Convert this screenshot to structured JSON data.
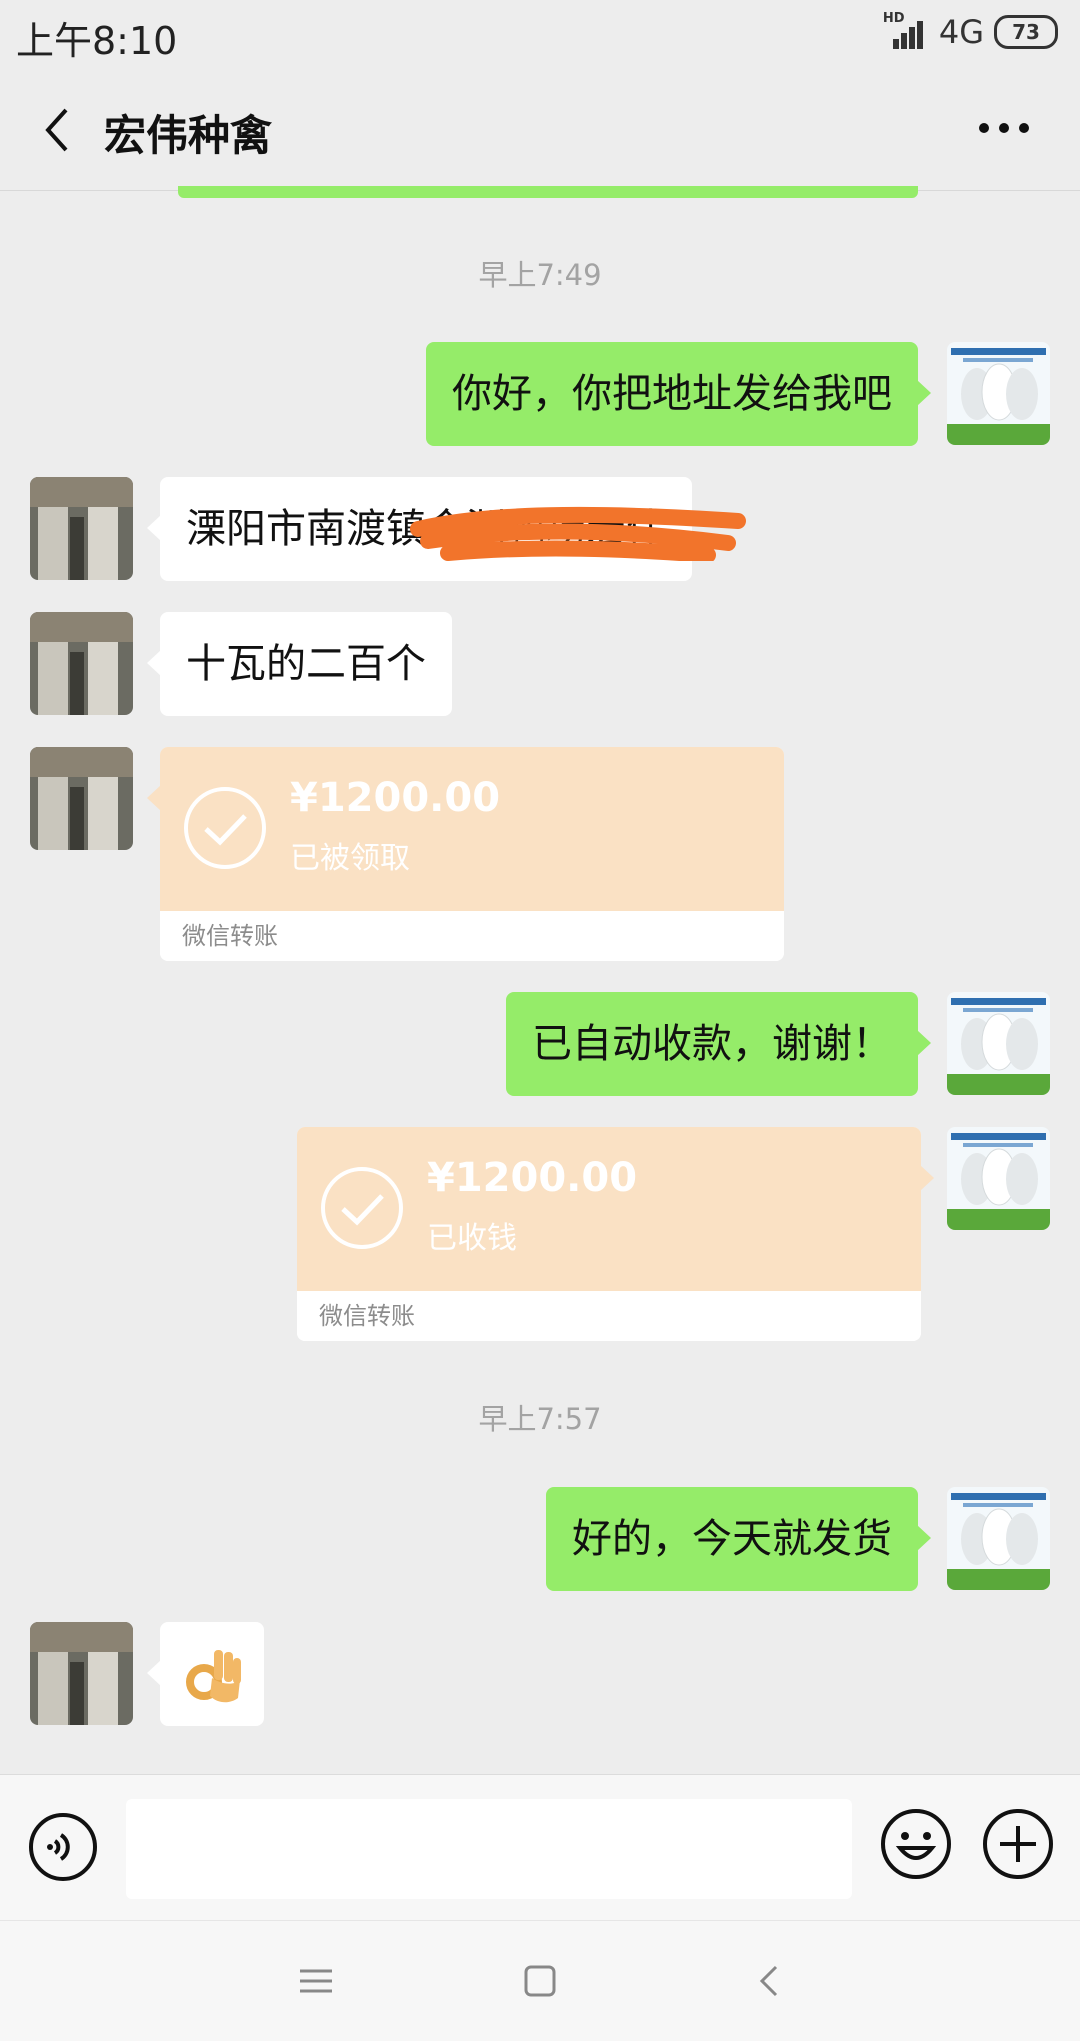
{
  "status_bar": {
    "time": "上午8:10",
    "hd": "HD",
    "network": "4G",
    "battery": "73"
  },
  "header": {
    "title": "宏伟种禽"
  },
  "messages": {
    "time1": "早上7:49",
    "msg1": "你好，你把地址发给我吧",
    "msg2": "溧阳市南渡镇金渊鸭场宏伟",
    "msg3": "十瓦的二百个",
    "transfer1": {
      "amount": "¥1200.00",
      "status": "已被领取",
      "footer": "微信转账"
    },
    "msg4": "已自动收款，谢谢！",
    "transfer2": {
      "amount": "¥1200.00",
      "status": "已收钱",
      "footer": "微信转账"
    },
    "time2": "早上7:57",
    "msg5": "好的，今天就发货",
    "emoji": "ok-hand-emoji"
  },
  "input_bar": {
    "placeholder": ""
  },
  "colors": {
    "sent_bubble": "#95ec69",
    "received_bubble": "#ffffff",
    "transfer_bg": "#fae1c4",
    "background": "#ededed",
    "redaction": "#f2742b"
  }
}
